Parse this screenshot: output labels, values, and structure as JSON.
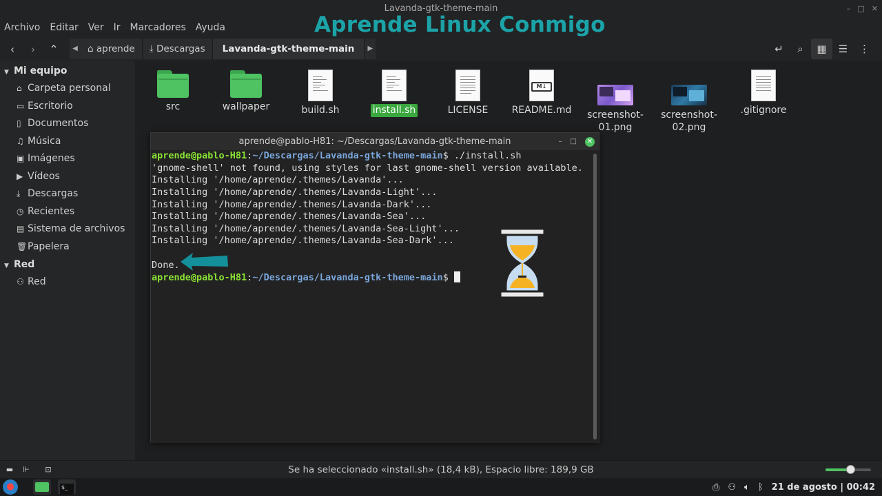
{
  "window": {
    "title": "Lavanda-gtk-theme-main"
  },
  "watermark": "Aprende Linux Conmigo",
  "menu": [
    "Archivo",
    "Editar",
    "Ver",
    "Ir",
    "Marcadores",
    "Ayuda"
  ],
  "breadcrumb": {
    "home": "aprende",
    "downloads": "Descargas",
    "current": "Lavanda-gtk-theme-main"
  },
  "sidebar": {
    "section1": "Mi equipo",
    "items1": [
      "Carpeta personal",
      "Escritorio",
      "Documentos",
      "Música",
      "Imágenes",
      "Vídeos",
      "Descargas",
      "Recientes",
      "Sistema de archivos",
      "Papelera"
    ],
    "section2": "Red",
    "items2": [
      "Red"
    ]
  },
  "files": [
    {
      "name": "src",
      "type": "folder"
    },
    {
      "name": "wallpaper",
      "type": "folder"
    },
    {
      "name": "build.sh",
      "type": "script"
    },
    {
      "name": "install.sh",
      "type": "script",
      "selected": true
    },
    {
      "name": "LICENSE",
      "type": "text"
    },
    {
      "name": "README.md",
      "type": "markdown"
    },
    {
      "name": "screenshot-\n01.png",
      "type": "image"
    },
    {
      "name": "screenshot-\n02.png",
      "type": "image"
    },
    {
      "name": ".gitignore",
      "type": "text"
    }
  ],
  "terminal": {
    "title": "aprende@pablo-H81: ~/Descargas/Lavanda-gtk-theme-main",
    "prompt_user": "aprende@pablo-H81",
    "prompt_path": "~/Descargas/Lavanda-gtk-theme-main",
    "command": "./install.sh",
    "output": [
      "'gnome-shell' not found, using styles for last gnome-shell version available.",
      "Installing '/home/aprende/.themes/Lavanda'...",
      "Installing '/home/aprende/.themes/Lavanda-Light'...",
      "Installing '/home/aprende/.themes/Lavanda-Dark'...",
      "Installing '/home/aprende/.themes/Lavanda-Sea'...",
      "Installing '/home/aprende/.themes/Lavanda-Sea-Light'...",
      "Installing '/home/aprende/.themes/Lavanda-Sea-Dark'...",
      "",
      "Done."
    ]
  },
  "status": {
    "text": "Se ha seleccionado «install.sh» (18,4 kB), Espacio libre: 189,9 GB",
    "zoom_fraction": 0.55
  },
  "taskbar": {
    "clock": "21 de agosto | 00:42"
  },
  "colors": {
    "accent": "#4fc262",
    "watermark": "#1ba3a8",
    "prompt_user": "#8ae234",
    "prompt_path": "#7aa6da"
  }
}
